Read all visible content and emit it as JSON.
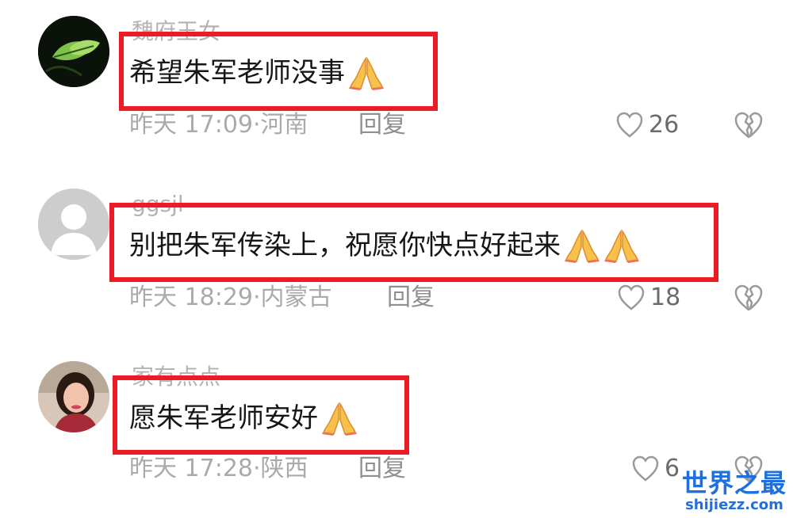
{
  "comments": [
    {
      "username": "魏府玉女",
      "text": "希望朱军老师没事",
      "emoji_count": 1,
      "time": "昨天 17:09",
      "location": "河南",
      "reply_label": "回复",
      "likes": "26"
    },
    {
      "username": "ggsjl",
      "text": "别把朱军传染上，祝愿你快点好起来",
      "emoji_count": 2,
      "time": "昨天 18:29",
      "location": "内蒙古",
      "reply_label": "回复",
      "likes": "18"
    },
    {
      "username": "家有点点",
      "text": "愿朱军老师安好",
      "emoji_count": 1,
      "time": "昨天 17:28",
      "location": "陕西",
      "reply_label": "回复",
      "likes": "6"
    }
  ],
  "icons": {
    "like": "heart-outline-icon",
    "dislike": "broken-heart-icon",
    "emoji": "folded-hands-emoji"
  },
  "colors": {
    "highlight_border": "#ec1c24",
    "watermark": "#1f6fe0"
  },
  "watermark": {
    "name": "世界之最",
    "url": "shijiezz.com"
  }
}
